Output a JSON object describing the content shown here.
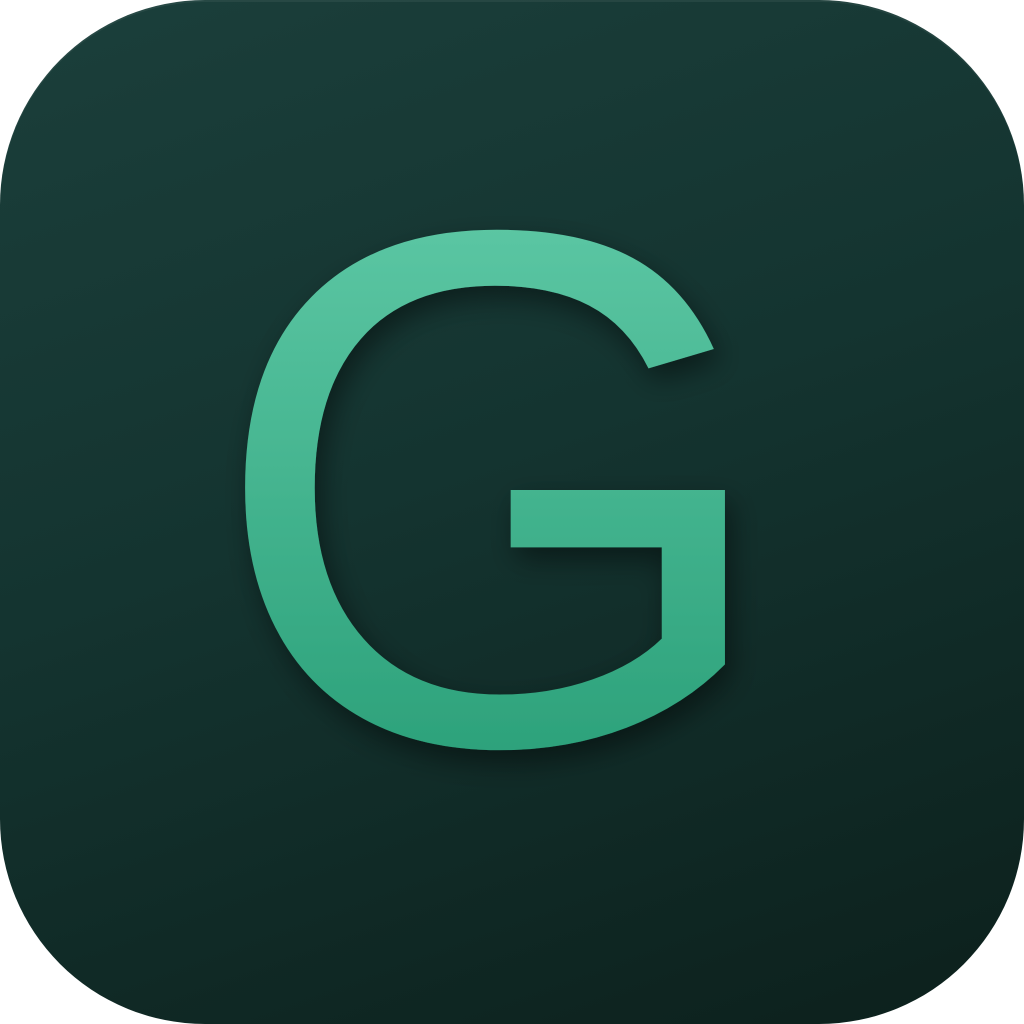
{
  "icon": {
    "letter": "G",
    "colors": {
      "background_top": "#1b3f3b",
      "background_bottom": "#0c201c",
      "letter_top": "#68d0ae",
      "letter_bottom": "#209870"
    }
  }
}
